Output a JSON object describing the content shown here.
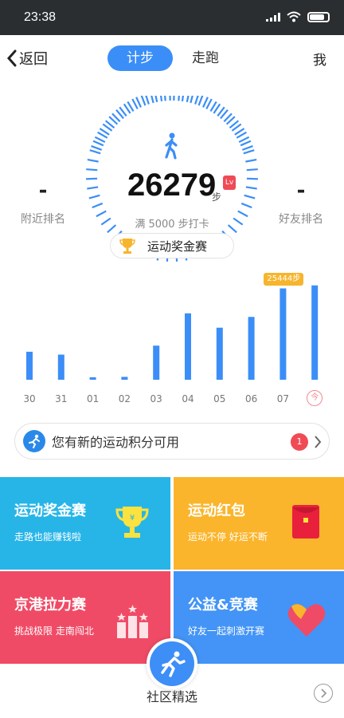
{
  "status_bar": {
    "time": "23:38"
  },
  "header": {
    "back_label": "返回",
    "tabs": [
      {
        "label": "计步",
        "active": true
      },
      {
        "label": "走跑",
        "active": false
      }
    ],
    "me_label": "我"
  },
  "gauge": {
    "steps": "26279",
    "steps_unit": "步",
    "badge": "Lv",
    "goal_text": "满 5000 步打卡",
    "nearby_rank_value": "-",
    "nearby_rank_label": "附近排名",
    "friend_rank_value": "-",
    "friend_rank_label": "好友排名",
    "prize_label": "运动奖金赛"
  },
  "chart_data": {
    "type": "bar",
    "categories": [
      "30",
      "31",
      "01",
      "02",
      "03",
      "04",
      "05",
      "06",
      "07",
      "今"
    ],
    "values": [
      7800,
      7000,
      700,
      800,
      9500,
      18500,
      14500,
      17500,
      25444,
      26279
    ],
    "tooltip": "25444步",
    "tooltip_index": 8,
    "ylim": [
      0,
      28000
    ],
    "color": "#3b8ef7"
  },
  "points_banner": {
    "text": "您有新的运动积分可用",
    "count": "1"
  },
  "tiles": [
    {
      "title": "运动奖金赛",
      "subtitle": "走路也能赚钱啦",
      "color": "#27b5e8"
    },
    {
      "title": "运动红包",
      "subtitle": "运动不停 好运不断",
      "color": "#fbb52c"
    },
    {
      "title": "京港拉力赛",
      "subtitle": "挑战极限 走南闯北",
      "color": "#f04b66"
    },
    {
      "title": "公益&竞赛",
      "subtitle": "好友一起刺激开赛",
      "color": "#4394f6"
    }
  ],
  "footer": {
    "label": "社区精选"
  }
}
